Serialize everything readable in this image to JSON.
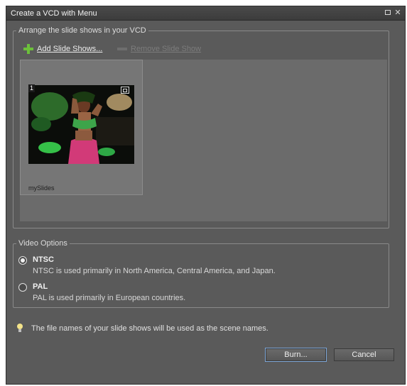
{
  "window": {
    "title": "Create a VCD with Menu"
  },
  "arrange": {
    "legend": "Arrange the slide shows in your VCD",
    "add_label": "Add Slide Shows...",
    "remove_label": "Remove Slide Show",
    "slides": [
      {
        "number": "1",
        "name": "mySlides"
      }
    ]
  },
  "video": {
    "legend": "Video Options",
    "ntsc_label": "NTSC",
    "ntsc_desc": "NTSC is used primarily in North America, Central America, and Japan.",
    "ntsc_selected": true,
    "pal_label": "PAL",
    "pal_desc": "PAL is used primarily in European countries.",
    "pal_selected": false
  },
  "tip": "The file names of your slide shows will be used as the scene names.",
  "buttons": {
    "burn": "Burn...",
    "cancel": "Cancel"
  },
  "colors": {
    "dialog_bg": "#5a5a5a",
    "add_icon": "#6cc03b",
    "focus_ring": "#7ea7d8"
  }
}
